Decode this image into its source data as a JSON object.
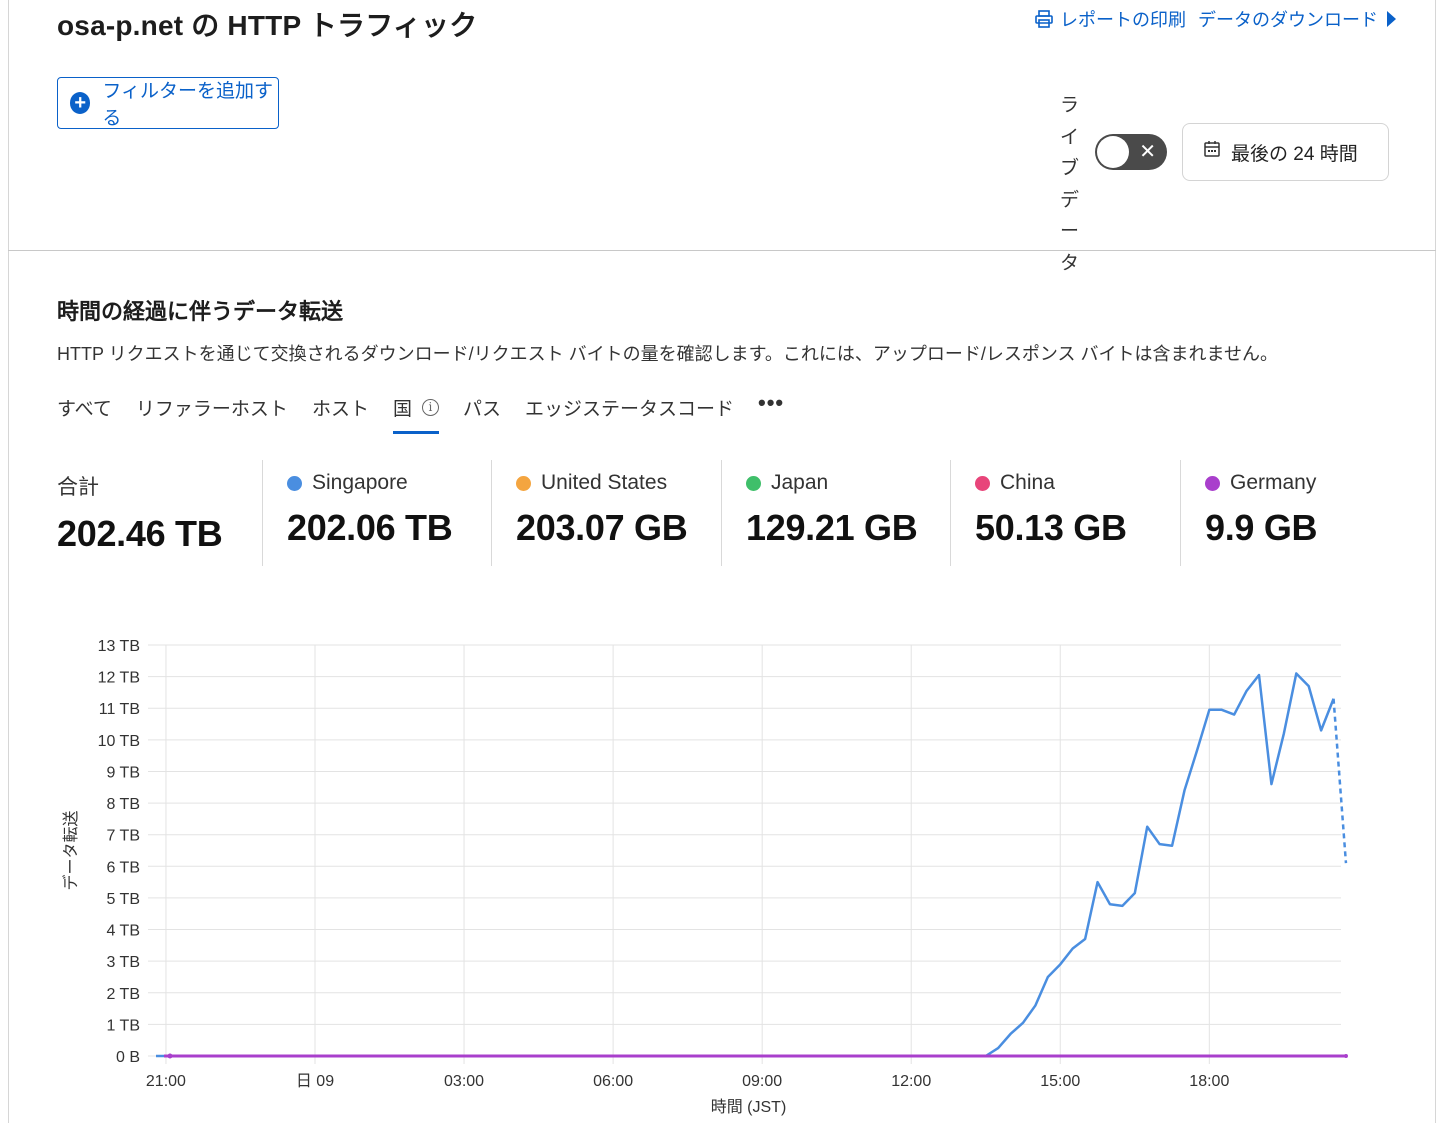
{
  "header": {
    "title": "osa-p.net の HTTP トラフィック",
    "print_report": "レポートの印刷",
    "download_data": "データのダウンロード",
    "add_filter": "フィルターを追加する",
    "live_data_label": [
      "ラ",
      "イ",
      "ブ",
      "デ",
      "ー",
      "タ"
    ],
    "live_data_on": false,
    "time_range": "最後の 24 時間"
  },
  "section": {
    "title": "時間の経過に伴うデータ転送",
    "description": "HTTP リクエストを通じて交換されるダウンロード/リクエスト バイトの量を確認します。これには、アップロード/レスポンス バイトは含まれません。"
  },
  "tabs": [
    {
      "label": "すべて",
      "active": false
    },
    {
      "label": "リファラーホスト",
      "active": false
    },
    {
      "label": "ホスト",
      "active": false
    },
    {
      "label": "国",
      "active": true,
      "info": true
    },
    {
      "label": "パス",
      "active": false
    },
    {
      "label": "エッジステータスコード",
      "active": false
    },
    {
      "label": "•••",
      "active": false
    }
  ],
  "stats": [
    {
      "label": "合計",
      "value": "202.46 TB",
      "color": null
    },
    {
      "label": "Singapore",
      "value": "202.06 TB",
      "color": "#4a8ee0"
    },
    {
      "label": "United States",
      "value": "203.07 GB",
      "color": "#f4a540"
    },
    {
      "label": "Japan",
      "value": "129.21 GB",
      "color": "#3fbf6a"
    },
    {
      "label": "China",
      "value": "50.13 GB",
      "color": "#e8457a"
    },
    {
      "label": "Germany",
      "value": "9.9 GB",
      "color": "#a93fcc"
    }
  ],
  "chart_data": {
    "type": "line",
    "xlabel": "時間 (JST)",
    "ylabel": "データ転送",
    "y_unit": "TB",
    "ylim": [
      0,
      13
    ],
    "y_ticks": [
      "0 B",
      "1 TB",
      "2 TB",
      "3 TB",
      "4 TB",
      "5 TB",
      "6 TB",
      "7 TB",
      "8 TB",
      "9 TB",
      "10 TB",
      "11 TB",
      "12 TB",
      "13 TB"
    ],
    "x_ticks": [
      "21:00",
      "日 09",
      "03:00",
      "06:00",
      "09:00",
      "12:00",
      "15:00",
      "18:00"
    ],
    "x_range_hours": [
      -0.2,
      23.65
    ],
    "x_tick_hours": [
      0,
      3,
      6,
      9,
      12,
      15,
      18,
      21
    ],
    "grid": true,
    "series": [
      {
        "name": "Singapore",
        "color": "#4a8ee0",
        "x_hours": [
          -0.2,
          16.5,
          16.75,
          17.0,
          17.25,
          17.5,
          17.75,
          18.0,
          18.25,
          18.5,
          18.75,
          19.0,
          19.25,
          19.5,
          19.75,
          20.0,
          20.25,
          20.5,
          20.75,
          21.0,
          21.25,
          21.5,
          21.75,
          22.0,
          22.25,
          22.5,
          22.75,
          23.0,
          23.25,
          23.5
        ],
        "values": [
          0,
          0,
          0.25,
          0.7,
          1.05,
          1.6,
          2.5,
          2.9,
          3.4,
          3.7,
          5.5,
          4.8,
          4.75,
          5.15,
          7.25,
          6.7,
          6.65,
          8.4,
          9.65,
          10.95,
          10.95,
          10.8,
          11.55,
          12.05,
          8.6,
          10.2,
          12.1,
          11.7,
          10.3,
          11.3
        ],
        "projected_tail": {
          "x_hours": [
            23.5,
            23.75
          ],
          "values": [
            11.3,
            6.1
          ]
        }
      },
      {
        "name": "United States",
        "color": "#f4a540",
        "values_constant": 0
      },
      {
        "name": "Japan",
        "color": "#3fbf6a",
        "values_constant": 0
      },
      {
        "name": "China",
        "color": "#e8457a",
        "values_constant": 0
      },
      {
        "name": "Germany",
        "color": "#a93fcc",
        "values_constant": 0
      }
    ]
  }
}
